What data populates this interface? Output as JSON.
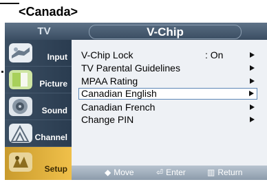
{
  "region_label": "<Canada>",
  "header": {
    "section": "TV",
    "title": "V-Chip"
  },
  "sidebar": {
    "items": [
      {
        "label": "Input",
        "icon": "input-icon",
        "active": false
      },
      {
        "label": "Picture",
        "icon": "picture-icon",
        "active": false
      },
      {
        "label": "Sound",
        "icon": "sound-icon",
        "active": false
      },
      {
        "label": "Channel",
        "icon": "channel-icon",
        "active": false
      },
      {
        "label": "Setup",
        "icon": "setup-icon",
        "active": true
      }
    ]
  },
  "menu": {
    "items": [
      {
        "label": "V-Chip Lock",
        "value": ": On",
        "arrow": true
      },
      {
        "label": "TV Parental Guidelines",
        "value": "",
        "arrow": true
      },
      {
        "label": "MPAA Rating",
        "value": "",
        "arrow": true
      },
      {
        "label": "Canadian English",
        "value": "",
        "arrow": true,
        "selected": true
      },
      {
        "label": "Canadian French",
        "value": "",
        "arrow": true
      },
      {
        "label": "Change PIN",
        "value": "",
        "arrow": true
      }
    ]
  },
  "help": {
    "move": {
      "icon": "◆",
      "label": "Move"
    },
    "enter": {
      "icon": "⏎",
      "label": "Enter"
    },
    "return": {
      "icon": "▥",
      "label": "Return"
    }
  },
  "colors": {
    "osd_background": "#2c3e52",
    "content_background": "#eef1f5",
    "active_tab": "#f0c04a",
    "highlight_border": "#5b86b5"
  }
}
